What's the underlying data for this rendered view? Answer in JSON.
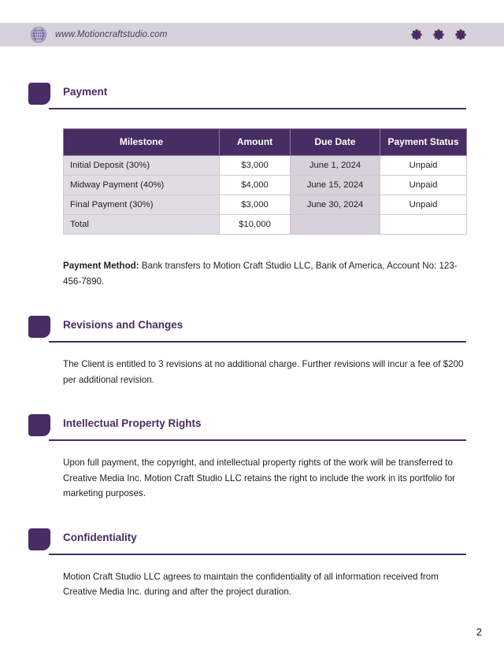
{
  "header": {
    "globe_icon": "globe-icon",
    "url": "www.Motioncraftstudio.com",
    "decoration_icon": "flower-dot-icon",
    "decoration_count": 3,
    "background_color": "#d6d1da",
    "text_color": "#4b3a63"
  },
  "theme": {
    "accent_purple": "#472d63",
    "table_header_bg": "#472d63",
    "shaded_cell_bg": "#d6d1da",
    "milestone_cell_bg": "#e0dce4",
    "body_text_color": "#1f1f1f"
  },
  "sections": {
    "payment": {
      "title": "Payment",
      "table": {
        "columns": [
          "Milestone",
          "Amount",
          "Due Date",
          "Payment Status"
        ],
        "rows": [
          {
            "milestone": "Initial Deposit (30%)",
            "amount": "$3,000",
            "due_date": "June 1, 2024",
            "status": "Unpaid"
          },
          {
            "milestone": "Midway Payment (40%)",
            "amount": "$4,000",
            "due_date": "June 15, 2024",
            "status": "Unpaid"
          },
          {
            "milestone": "Final Payment (30%)",
            "amount": "$3,000",
            "due_date": "June 30, 2024",
            "status": "Unpaid"
          },
          {
            "milestone": "Total",
            "amount": "$10,000",
            "due_date": "",
            "status": ""
          }
        ]
      },
      "payment_method_label": "Payment Method:",
      "payment_method_text": " Bank transfers to Motion Craft Studio LLC, Bank of America, Account No: 123-456-7890."
    },
    "revisions": {
      "title": "Revisions and Changes",
      "body": "The Client is entitled to 3 revisions at no additional charge. Further revisions will incur a fee of $200 per additional revision."
    },
    "ip_rights": {
      "title": "Intellectual Property Rights",
      "body": "Upon full payment, the copyright, and intellectual property rights of the work will be transferred to Creative Media Inc. Motion Craft Studio LLC retains the right to include the work in its portfolio for marketing purposes."
    },
    "confidentiality": {
      "title": "Confidentiality",
      "body": "Motion Craft Studio LLC agrees to maintain the confidentiality of all information received from Creative Media Inc. during and after the project duration."
    }
  },
  "footer": {
    "page_number": "2"
  }
}
